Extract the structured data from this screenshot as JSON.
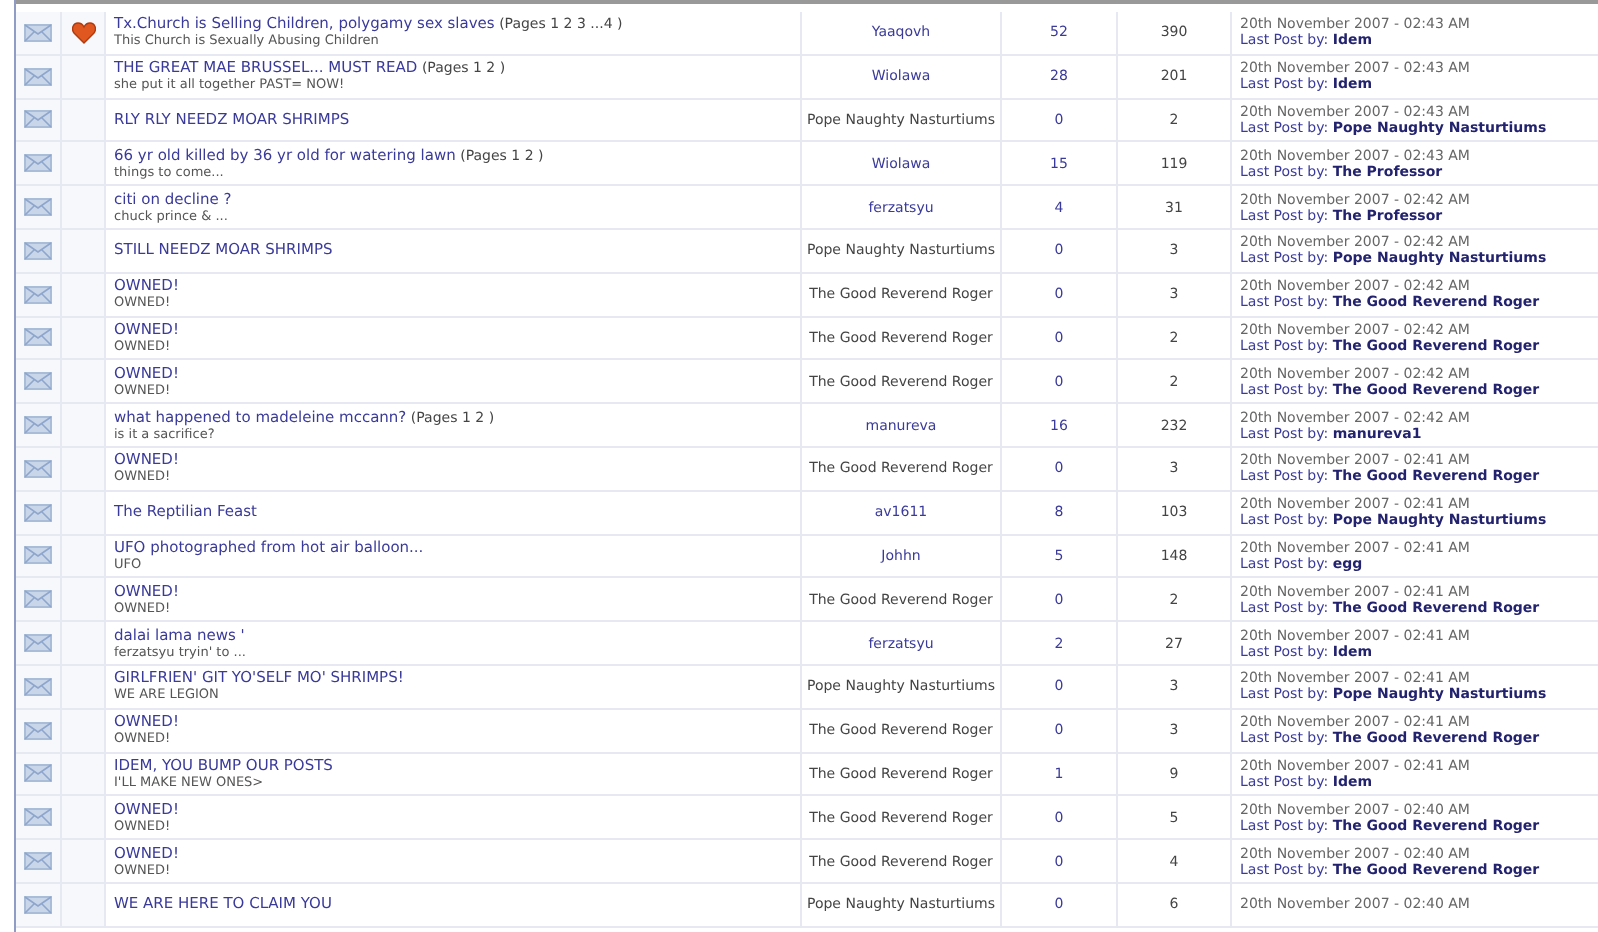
{
  "topics": [
    {
      "title": "Tx.Church is Selling Children, polygamy sex slaves",
      "pages": "(Pages 1 2 3 ...4 )",
      "description": "This Church is Sexually Abusing Children",
      "hot": true,
      "starter": "Yaaqovh",
      "starter_is_link": true,
      "replies": "52",
      "views": "390",
      "date": "20th November 2007 - 02:43 AM",
      "last_post_label": "Last Post by:",
      "last_poster": "Idem"
    },
    {
      "title": "THE GREAT MAE BRUSSEL... MUST READ",
      "pages": "(Pages 1 2 )",
      "description": "she put it all together PAST= NOW!",
      "hot": false,
      "starter": "Wiolawa",
      "starter_is_link": true,
      "replies": "28",
      "views": "201",
      "date": "20th November 2007 - 02:43 AM",
      "last_post_label": "Last Post by:",
      "last_poster": "Idem"
    },
    {
      "title": "RLY RLY NEEDZ MOAR SHRIMPS",
      "hot": false,
      "starter": "Pope Naughty Nasturtiums",
      "starter_is_link": false,
      "replies": "0",
      "views": "2",
      "date": "20th November 2007 - 02:43 AM",
      "last_post_label": "Last Post by:",
      "last_poster": "Pope Naughty Nasturtiums"
    },
    {
      "title": "66 yr old killed by 36 yr old for watering lawn",
      "pages": "(Pages 1 2 )",
      "description": "things to come...",
      "hot": false,
      "starter": "Wiolawa",
      "starter_is_link": true,
      "replies": "15",
      "views": "119",
      "date": "20th November 2007 - 02:43 AM",
      "last_post_label": "Last Post by:",
      "last_poster": "The Professor"
    },
    {
      "title": "citi on decline ?",
      "description": "chuck prince & ...",
      "hot": false,
      "starter": "ferzatsyu",
      "starter_is_link": true,
      "replies": "4",
      "views": "31",
      "date": "20th November 2007 - 02:42 AM",
      "last_post_label": "Last Post by:",
      "last_poster": "The Professor"
    },
    {
      "title": "STILL NEEDZ MOAR SHRIMPS",
      "hot": false,
      "starter": "Pope Naughty Nasturtiums",
      "starter_is_link": false,
      "replies": "0",
      "views": "3",
      "date": "20th November 2007 - 02:42 AM",
      "last_post_label": "Last Post by:",
      "last_poster": "Pope Naughty Nasturtiums"
    },
    {
      "title": "OWNED!",
      "description": "OWNED!",
      "hot": false,
      "starter": "The Good Reverend Roger",
      "starter_is_link": false,
      "replies": "0",
      "views": "3",
      "date": "20th November 2007 - 02:42 AM",
      "last_post_label": "Last Post by:",
      "last_poster": "The Good Reverend Roger"
    },
    {
      "title": "OWNED!",
      "description": "OWNED!",
      "hot": false,
      "starter": "The Good Reverend Roger",
      "starter_is_link": false,
      "replies": "0",
      "views": "2",
      "date": "20th November 2007 - 02:42 AM",
      "last_post_label": "Last Post by:",
      "last_poster": "The Good Reverend Roger"
    },
    {
      "title": "OWNED!",
      "description": "OWNED!",
      "hot": false,
      "starter": "The Good Reverend Roger",
      "starter_is_link": false,
      "replies": "0",
      "views": "2",
      "date": "20th November 2007 - 02:42 AM",
      "last_post_label": "Last Post by:",
      "last_poster": "The Good Reverend Roger"
    },
    {
      "title": "what happened to madeleine mccann?",
      "pages": "(Pages 1 2 )",
      "description": "is it a sacrifice?",
      "hot": false,
      "starter": "manureva",
      "starter_is_link": true,
      "replies": "16",
      "views": "232",
      "date": "20th November 2007 - 02:42 AM",
      "last_post_label": "Last Post by:",
      "last_poster": "manureva1"
    },
    {
      "title": "OWNED!",
      "description": "OWNED!",
      "hot": false,
      "starter": "The Good Reverend Roger",
      "starter_is_link": false,
      "replies": "0",
      "views": "3",
      "date": "20th November 2007 - 02:41 AM",
      "last_post_label": "Last Post by:",
      "last_poster": "The Good Reverend Roger"
    },
    {
      "title": "The Reptilian Feast",
      "hot": false,
      "starter": "av1611",
      "starter_is_link": true,
      "replies": "8",
      "views": "103",
      "date": "20th November 2007 - 02:41 AM",
      "last_post_label": "Last Post by:",
      "last_poster": "Pope Naughty Nasturtiums"
    },
    {
      "title": "UFO photographed from hot air balloon...",
      "description": "UFO",
      "hot": false,
      "starter": "Johhn",
      "starter_is_link": true,
      "replies": "5",
      "views": "148",
      "date": "20th November 2007 - 02:41 AM",
      "last_post_label": "Last Post by:",
      "last_poster": "egg"
    },
    {
      "title": "OWNED!",
      "description": "OWNED!",
      "hot": false,
      "starter": "The Good Reverend Roger",
      "starter_is_link": false,
      "replies": "0",
      "views": "2",
      "date": "20th November 2007 - 02:41 AM",
      "last_post_label": "Last Post by:",
      "last_poster": "The Good Reverend Roger"
    },
    {
      "title": "dalai lama news '",
      "description": "ferzatsyu tryin' to ...",
      "hot": false,
      "starter": "ferzatsyu",
      "starter_is_link": true,
      "replies": "2",
      "views": "27",
      "date": "20th November 2007 - 02:41 AM",
      "last_post_label": "Last Post by:",
      "last_poster": "Idem"
    },
    {
      "title": "GIRLFRIEN' GIT YO'SELF MO' SHRIMPS!",
      "description": "WE ARE LEGION",
      "hot": false,
      "starter": "Pope Naughty Nasturtiums",
      "starter_is_link": false,
      "replies": "0",
      "views": "3",
      "date": "20th November 2007 - 02:41 AM",
      "last_post_label": "Last Post by:",
      "last_poster": "Pope Naughty Nasturtiums"
    },
    {
      "title": "OWNED!",
      "description": "OWNED!",
      "hot": false,
      "starter": "The Good Reverend Roger",
      "starter_is_link": false,
      "replies": "0",
      "views": "3",
      "date": "20th November 2007 - 02:41 AM",
      "last_post_label": "Last Post by:",
      "last_poster": "The Good Reverend Roger"
    },
    {
      "title": "IDEM, YOU BUMP OUR POSTS",
      "description": "I'LL MAKE NEW ONES>",
      "hot": false,
      "starter": "The Good Reverend Roger",
      "starter_is_link": false,
      "replies": "1",
      "views": "9",
      "date": "20th November 2007 - 02:41 AM",
      "last_post_label": "Last Post by:",
      "last_poster": "Idem"
    },
    {
      "title": "OWNED!",
      "description": "OWNED!",
      "hot": false,
      "starter": "The Good Reverend Roger",
      "starter_is_link": false,
      "replies": "0",
      "views": "5",
      "date": "20th November 2007 - 02:40 AM",
      "last_post_label": "Last Post by:",
      "last_poster": "The Good Reverend Roger"
    },
    {
      "title": "OWNED!",
      "description": "OWNED!",
      "hot": false,
      "starter": "The Good Reverend Roger",
      "starter_is_link": false,
      "replies": "0",
      "views": "4",
      "date": "20th November 2007 - 02:40 AM",
      "last_post_label": "Last Post by:",
      "last_poster": "The Good Reverend Roger"
    },
    {
      "title": "WE ARE HERE TO CLAIM YOU",
      "hot": false,
      "starter": "Pope Naughty Nasturtiums",
      "starter_is_link": false,
      "replies": "0",
      "views": "6",
      "date": "20th November 2007 - 02:40 AM"
    }
  ]
}
